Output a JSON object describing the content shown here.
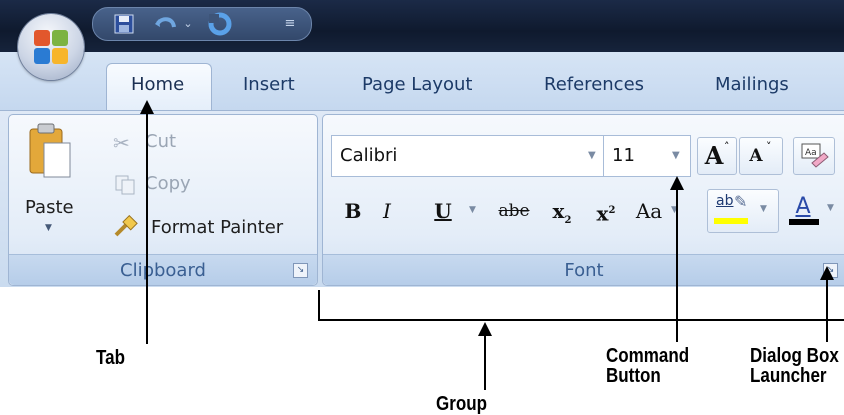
{
  "quick_access": {
    "icons": [
      "save-icon",
      "undo-icon",
      "dropdown-arrow-icon",
      "redo-icon",
      "customize-icon"
    ]
  },
  "tabs": [
    {
      "label": "Home",
      "active": true
    },
    {
      "label": "Insert"
    },
    {
      "label": "Page Layout"
    },
    {
      "label": "References"
    },
    {
      "label": "Mailings"
    }
  ],
  "clipboard": {
    "paste_label": "Paste",
    "cut_label": "Cut",
    "copy_label": "Copy",
    "format_painter_label": "Format Painter",
    "group_label": "Clipboard"
  },
  "font": {
    "font_name": "Calibri",
    "font_size": "11",
    "grow_font": "A",
    "shrink_font": "A",
    "bold": "B",
    "italic": "I",
    "underline": "U",
    "strikethrough": "abe",
    "subscript": "x",
    "superscript": "x",
    "change_case": "Aa",
    "highlight_text": "ab",
    "font_color": "A",
    "group_label": "Font"
  },
  "annotations": {
    "tab": "Tab",
    "group": "Group",
    "command_button": "Command Button",
    "dialog_box_launcher": "Dialog Box Launcher"
  },
  "colors": {
    "ribbon_bg": "#cadbef",
    "tab_text": "#1c3a67",
    "group_label": "#3a5f92",
    "highlight_yellow": "#ffff00",
    "font_color_red": "#000000"
  }
}
